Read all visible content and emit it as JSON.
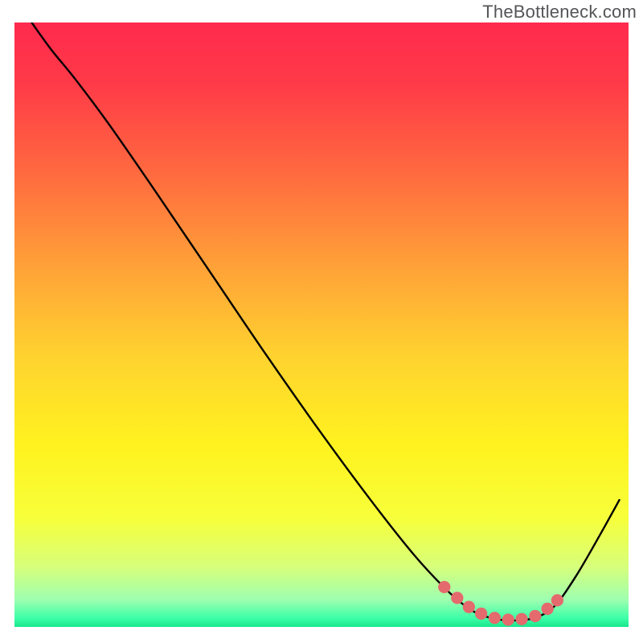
{
  "watermark": "TheBottleneck.com",
  "chart_data": {
    "type": "line",
    "title": "",
    "xlabel": "",
    "ylabel": "",
    "xlim": [
      0,
      1
    ],
    "ylim": [
      0,
      1
    ],
    "gradient_stops": [
      {
        "offset": 0.0,
        "color": "#ff2a4d"
      },
      {
        "offset": 0.1,
        "color": "#ff3a48"
      },
      {
        "offset": 0.25,
        "color": "#ff6a3f"
      },
      {
        "offset": 0.4,
        "color": "#ffa038"
      },
      {
        "offset": 0.55,
        "color": "#ffd22f"
      },
      {
        "offset": 0.7,
        "color": "#fff21f"
      },
      {
        "offset": 0.82,
        "color": "#f7ff3a"
      },
      {
        "offset": 0.9,
        "color": "#d7ff7a"
      },
      {
        "offset": 0.955,
        "color": "#9effb0"
      },
      {
        "offset": 0.985,
        "color": "#3effa8"
      },
      {
        "offset": 1.0,
        "color": "#19e78d"
      }
    ],
    "series": [
      {
        "name": "bottleneck-curve",
        "color": "#000000",
        "points": [
          {
            "x": 0.028,
            "y": 1.0
          },
          {
            "x": 0.06,
            "y": 0.955
          },
          {
            "x": 0.1,
            "y": 0.905
          },
          {
            "x": 0.155,
            "y": 0.83
          },
          {
            "x": 0.23,
            "y": 0.72
          },
          {
            "x": 0.32,
            "y": 0.585
          },
          {
            "x": 0.41,
            "y": 0.45
          },
          {
            "x": 0.5,
            "y": 0.32
          },
          {
            "x": 0.58,
            "y": 0.21
          },
          {
            "x": 0.65,
            "y": 0.12
          },
          {
            "x": 0.7,
            "y": 0.065
          },
          {
            "x": 0.735,
            "y": 0.034
          },
          {
            "x": 0.76,
            "y": 0.02
          },
          {
            "x": 0.79,
            "y": 0.012
          },
          {
            "x": 0.82,
            "y": 0.011
          },
          {
            "x": 0.85,
            "y": 0.016
          },
          {
            "x": 0.88,
            "y": 0.035
          },
          {
            "x": 0.915,
            "y": 0.085
          },
          {
            "x": 0.955,
            "y": 0.155
          },
          {
            "x": 0.985,
            "y": 0.21
          }
        ]
      }
    ],
    "markers": {
      "name": "low-bottleneck-zone",
      "color": "#e46a6d",
      "radius_norm": 0.01,
      "points": [
        {
          "x": 0.7,
          "y": 0.066
        },
        {
          "x": 0.721,
          "y": 0.048
        },
        {
          "x": 0.74,
          "y": 0.033
        },
        {
          "x": 0.76,
          "y": 0.022
        },
        {
          "x": 0.782,
          "y": 0.015
        },
        {
          "x": 0.804,
          "y": 0.012
        },
        {
          "x": 0.826,
          "y": 0.013
        },
        {
          "x": 0.848,
          "y": 0.018
        },
        {
          "x": 0.868,
          "y": 0.03
        },
        {
          "x": 0.884,
          "y": 0.044
        }
      ]
    }
  }
}
